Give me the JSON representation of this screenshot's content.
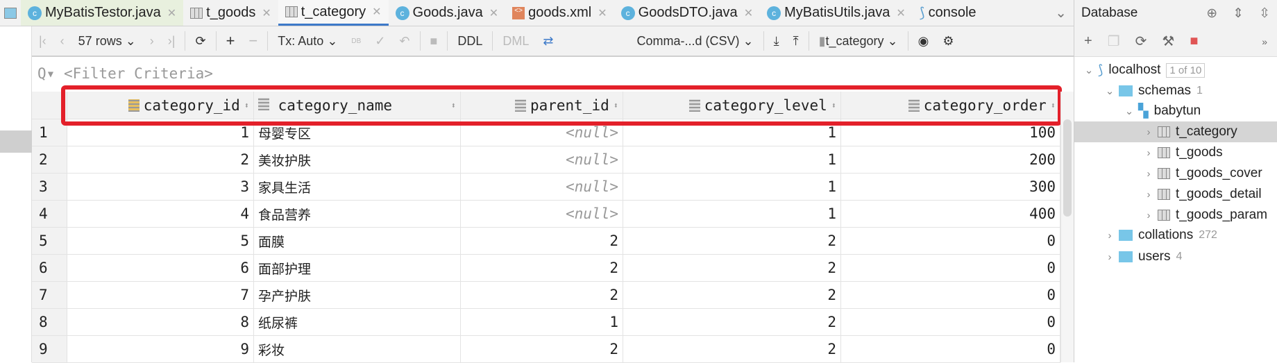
{
  "tabs": [
    {
      "label": "MyBatisTestor.java",
      "icon": "java-class-icon",
      "active": false
    },
    {
      "label": "t_goods",
      "icon": "table-icon",
      "active": false
    },
    {
      "label": "t_category",
      "icon": "table-icon",
      "active": true
    },
    {
      "label": "Goods.java",
      "icon": "java-class-icon",
      "active": false
    },
    {
      "label": "goods.xml",
      "icon": "xml-icon",
      "active": false
    },
    {
      "label": "GoodsDTO.java",
      "icon": "java-class-icon",
      "active": false
    },
    {
      "label": "MyBatisUtils.java",
      "icon": "java-class-icon",
      "active": false
    },
    {
      "label": "console",
      "icon": "mysql-icon",
      "active": false
    }
  ],
  "toolbar": {
    "rows": "57 rows",
    "tx": "Tx: Auto",
    "db": "DB",
    "ddl": "DDL",
    "dml": "DML",
    "export_format": "Comma-...d (CSV)",
    "table": "t_category"
  },
  "filter": {
    "placeholder": "<Filter Criteria>"
  },
  "grid": {
    "columns": [
      "category_id",
      "category_name",
      "parent_id",
      "category_level",
      "category_order"
    ],
    "rows": [
      {
        "n": "1",
        "id": "1",
        "name": "母婴专区",
        "parent": "<null>",
        "level": "1",
        "order": "100"
      },
      {
        "n": "2",
        "id": "2",
        "name": "美妆护肤",
        "parent": "<null>",
        "level": "1",
        "order": "200"
      },
      {
        "n": "3",
        "id": "3",
        "name": "家具生活",
        "parent": "<null>",
        "level": "1",
        "order": "300"
      },
      {
        "n": "4",
        "id": "4",
        "name": "食品营养",
        "parent": "<null>",
        "level": "1",
        "order": "400"
      },
      {
        "n": "5",
        "id": "5",
        "name": "面膜",
        "parent": "2",
        "level": "2",
        "order": "0"
      },
      {
        "n": "6",
        "id": "6",
        "name": "面部护理",
        "parent": "2",
        "level": "2",
        "order": "0"
      },
      {
        "n": "7",
        "id": "7",
        "name": "孕产护肤",
        "parent": "2",
        "level": "2",
        "order": "0"
      },
      {
        "n": "8",
        "id": "8",
        "name": "纸尿裤",
        "parent": "1",
        "level": "2",
        "order": "0"
      },
      {
        "n": "9",
        "id": "9",
        "name": "彩妆",
        "parent": "2",
        "level": "2",
        "order": "0"
      }
    ]
  },
  "database": {
    "title": "Database",
    "tree": {
      "host": "localhost",
      "host_badge": "1 of 10",
      "schemas": "schemas",
      "schemas_count": "1",
      "schema": "babytun",
      "tables": [
        "t_category",
        "t_goods",
        "t_goods_cover",
        "t_goods_detail",
        "t_goods_param"
      ],
      "collations": "collations",
      "collations_count": "272",
      "users": "users",
      "users_count": "4"
    }
  },
  "colors": {
    "accent": "#3d7ac9",
    "highlight": "#e3202a"
  }
}
